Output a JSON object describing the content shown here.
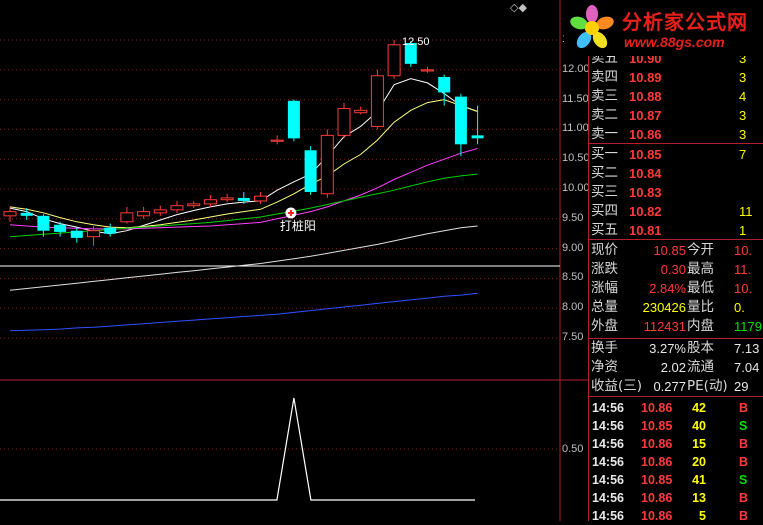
{
  "logo": {
    "brand": "分析家公式网",
    "url": "www.88gs.com"
  },
  "corner_icons": "◇◆",
  "chart_labels": {
    "high_marker": "12.50",
    "signal": "打桩阳"
  },
  "price_axis": [
    "12.50",
    "12.00",
    "11.50",
    "11.00",
    "10.50",
    "10.00",
    "9.50",
    "9.00",
    "8.50",
    "8.00",
    "7.50"
  ],
  "sub_axis": [
    "0.50"
  ],
  "order_book": {
    "asks": [
      {
        "label": "卖五",
        "price": "10.90",
        "vol": "3"
      },
      {
        "label": "卖四",
        "price": "10.89",
        "vol": "3"
      },
      {
        "label": "卖三",
        "price": "10.88",
        "vol": "4"
      },
      {
        "label": "卖二",
        "price": "10.87",
        "vol": "3"
      },
      {
        "label": "卖一",
        "price": "10.86",
        "vol": "3"
      }
    ],
    "bids": [
      {
        "label": "买一",
        "price": "10.85",
        "vol": "7"
      },
      {
        "label": "买二",
        "price": "10.84",
        "vol": ""
      },
      {
        "label": "买三",
        "price": "10.83",
        "vol": ""
      },
      {
        "label": "买四",
        "price": "10.82",
        "vol": "11"
      },
      {
        "label": "买五",
        "price": "10.81",
        "vol": "1"
      }
    ]
  },
  "quote": [
    {
      "k1": "现价",
      "v1": "10.85",
      "c1": "red",
      "k2": "今开",
      "v2": "10.",
      "c2": "red"
    },
    {
      "k1": "涨跌",
      "v1": "0.30",
      "c1": "red",
      "k2": "最高",
      "v2": "11.",
      "c2": "red"
    },
    {
      "k1": "涨幅",
      "v1": "2.84%",
      "c1": "red",
      "k2": "最低",
      "v2": "10.",
      "c2": "red"
    },
    {
      "k1": "总量",
      "v1": "230426",
      "c1": "yel",
      "k2": "量比",
      "v2": "0.",
      "c2": "yel"
    },
    {
      "k1": "外盘",
      "v1": "112431",
      "c1": "red",
      "k2": "内盘",
      "v2": "1179",
      "c2": "grn"
    }
  ],
  "fundamentals": [
    {
      "k1": "换手",
      "v1": "3.27%",
      "k2": "股本",
      "v2": "7.13"
    },
    {
      "k1": "净资",
      "v1": "2.02",
      "k2": "流通",
      "v2": "7.04"
    },
    {
      "k1": "收益(三)",
      "v1": "0.277",
      "k2": "PE(动)",
      "v2": "29"
    }
  ],
  "ticks": [
    {
      "time": "14:56",
      "price": "10.86",
      "vol": "42",
      "side": "B"
    },
    {
      "time": "14:56",
      "price": "10.85",
      "vol": "40",
      "side": "S"
    },
    {
      "time": "14:56",
      "price": "10.86",
      "vol": "15",
      "side": "B"
    },
    {
      "time": "14:56",
      "price": "10.86",
      "vol": "20",
      "side": "B"
    },
    {
      "time": "14:56",
      "price": "10.85",
      "vol": "41",
      "side": "S"
    },
    {
      "time": "14:56",
      "price": "10.86",
      "vol": "13",
      "side": "B"
    },
    {
      "time": "14:56",
      "price": "10.86",
      "vol": "5",
      "side": "B"
    }
  ],
  "colors": {
    "up": "#ff3a3a",
    "down": "#00ffff",
    "grid": "#8b1a1a",
    "ma5": "#ffffff",
    "ma10": "#ffff80",
    "ma20": "#ff40ff",
    "ma30": "#00d000",
    "ma60": "#e0e0e0",
    "ma120": "#3050ff"
  },
  "chart_data": {
    "type": "candlestick",
    "price_range": [
      7.3,
      12.75
    ],
    "candles": [
      {
        "o": 9.55,
        "c": 9.62,
        "h": 9.7,
        "l": 9.45
      },
      {
        "o": 9.6,
        "c": 9.55,
        "h": 9.68,
        "l": 9.48
      },
      {
        "o": 9.55,
        "c": 9.3,
        "h": 9.58,
        "l": 9.2
      },
      {
        "o": 9.4,
        "c": 9.28,
        "h": 9.45,
        "l": 9.2
      },
      {
        "o": 9.3,
        "c": 9.18,
        "h": 9.35,
        "l": 9.1
      },
      {
        "o": 9.2,
        "c": 9.3,
        "h": 9.38,
        "l": 9.05
      },
      {
        "o": 9.35,
        "c": 9.25,
        "h": 9.42,
        "l": 9.2
      },
      {
        "o": 9.45,
        "c": 9.6,
        "h": 9.7,
        "l": 9.42
      },
      {
        "o": 9.55,
        "c": 9.62,
        "h": 9.7,
        "l": 9.5
      },
      {
        "o": 9.6,
        "c": 9.65,
        "h": 9.72,
        "l": 9.55
      },
      {
        "o": 9.65,
        "c": 9.72,
        "h": 9.8,
        "l": 9.6
      },
      {
        "o": 9.72,
        "c": 9.75,
        "h": 9.8,
        "l": 9.68
      },
      {
        "o": 9.75,
        "c": 9.82,
        "h": 9.9,
        "l": 9.7
      },
      {
        "o": 9.82,
        "c": 9.85,
        "h": 9.92,
        "l": 9.78
      },
      {
        "o": 9.85,
        "c": 9.8,
        "h": 9.95,
        "l": 9.75
      },
      {
        "o": 9.8,
        "c": 9.88,
        "h": 9.95,
        "l": 9.75
      },
      {
        "o": 10.8,
        "c": 10.82,
        "h": 10.9,
        "l": 10.75
      },
      {
        "o": 11.48,
        "c": 10.85,
        "h": 11.5,
        "l": 10.8
      },
      {
        "o": 10.65,
        "c": 9.95,
        "h": 10.72,
        "l": 9.9
      },
      {
        "o": 9.92,
        "c": 10.9,
        "h": 11.0,
        "l": 9.85
      },
      {
        "o": 10.9,
        "c": 11.35,
        "h": 11.45,
        "l": 10.85
      },
      {
        "o": 11.28,
        "c": 11.32,
        "h": 11.38,
        "l": 11.25
      },
      {
        "o": 11.05,
        "c": 11.9,
        "h": 12.0,
        "l": 11.0
      },
      {
        "o": 11.9,
        "c": 12.42,
        "h": 12.5,
        "l": 11.85
      },
      {
        "o": 12.45,
        "c": 12.1,
        "h": 12.48,
        "l": 12.05
      },
      {
        "o": 11.98,
        "c": 12.0,
        "h": 12.05,
        "l": 11.95
      },
      {
        "o": 11.88,
        "c": 11.62,
        "h": 11.92,
        "l": 11.4
      },
      {
        "o": 11.55,
        "c": 10.75,
        "h": 11.6,
        "l": 10.55
      },
      {
        "o": 10.9,
        "c": 10.85,
        "h": 11.4,
        "l": 10.75
      }
    ],
    "ma": [
      {
        "name": "MA5",
        "values": [
          9.68,
          9.62,
          9.5,
          9.42,
          9.36,
          9.29,
          9.25,
          9.3,
          9.39,
          9.48,
          9.57,
          9.64,
          9.7,
          9.75,
          9.78,
          9.8,
          9.98,
          10.12,
          10.25,
          10.55,
          10.88,
          11.05,
          11.3,
          11.75,
          11.85,
          11.78,
          11.6,
          11.4,
          11.3
        ]
      },
      {
        "name": "MA10",
        "values": [
          9.7,
          9.66,
          9.6,
          9.52,
          9.45,
          9.4,
          9.36,
          9.35,
          9.37,
          9.4,
          9.44,
          9.48,
          9.53,
          9.58,
          9.62,
          9.66,
          9.78,
          9.92,
          10.08,
          10.22,
          10.42,
          10.58,
          10.82,
          11.12,
          11.32,
          11.45,
          11.5,
          11.4,
          11.3
        ]
      },
      {
        "name": "MA20",
        "values": [
          9.4,
          9.38,
          9.36,
          9.35,
          9.34,
          9.33,
          9.33,
          9.33,
          9.34,
          9.35,
          9.36,
          9.37,
          9.38,
          9.4,
          9.42,
          9.44,
          9.5,
          9.56,
          9.62,
          9.7,
          9.8,
          9.9,
          10.02,
          10.16,
          10.28,
          10.4,
          10.5,
          10.6,
          10.68
        ]
      },
      {
        "name": "MA30",
        "values": [
          9.2,
          9.22,
          9.24,
          9.26,
          9.28,
          9.3,
          9.32,
          9.34,
          9.36,
          9.38,
          9.4,
          9.42,
          9.44,
          9.47,
          9.5,
          9.53,
          9.58,
          9.63,
          9.68,
          9.74,
          9.8,
          9.86,
          9.92,
          9.98,
          10.05,
          10.12,
          10.18,
          10.22,
          10.25
        ]
      },
      {
        "name": "MA60",
        "values": [
          8.3,
          8.33,
          8.36,
          8.39,
          8.42,
          8.45,
          8.48,
          8.51,
          8.54,
          8.57,
          8.6,
          8.63,
          8.66,
          8.69,
          8.72,
          8.75,
          8.79,
          8.83,
          8.87,
          8.92,
          8.97,
          9.02,
          9.07,
          9.13,
          9.19,
          9.25,
          9.3,
          9.35,
          9.38
        ]
      },
      {
        "name": "MA120",
        "values": [
          7.62,
          7.63,
          7.64,
          7.65,
          7.67,
          7.68,
          7.7,
          7.72,
          7.74,
          7.76,
          7.78,
          7.8,
          7.82,
          7.84,
          7.86,
          7.88,
          7.9,
          7.93,
          7.96,
          7.99,
          8.02,
          8.05,
          8.08,
          8.11,
          8.14,
          8.17,
          8.2,
          8.22,
          8.25
        ]
      }
    ],
    "signal": {
      "index": 17,
      "label": "打桩阳"
    },
    "sub_indicator": {
      "range": [
        0,
        1
      ],
      "spike_index": 17,
      "values": "0 except spike to 1 at index 17"
    }
  }
}
